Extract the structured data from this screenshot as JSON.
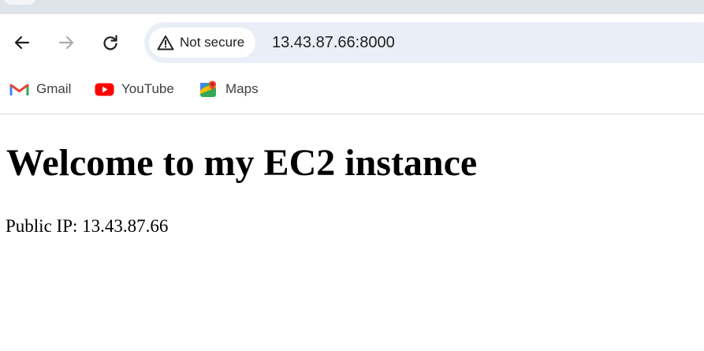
{
  "browser": {
    "security_label": "Not secure",
    "url": "13.43.87.66:8000",
    "bookmarks": [
      {
        "label": "Gmail",
        "icon": "gmail-icon"
      },
      {
        "label": "YouTube",
        "icon": "youtube-icon"
      },
      {
        "label": "Maps",
        "icon": "maps-icon"
      }
    ],
    "colors": {
      "tabstrip": "#dfe3ea",
      "omnibox": "#eaeef6",
      "youtube_red": "#ff0000",
      "gmail_red": "#ea4335"
    }
  },
  "page": {
    "heading": "Welcome to my EC2 instance",
    "ip_line": "Public IP: 13.43.87.66"
  }
}
